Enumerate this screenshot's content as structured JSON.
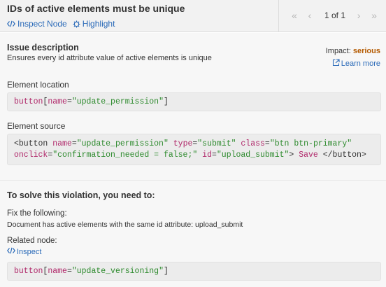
{
  "header": {
    "title": "IDs of active elements must be unique",
    "inspect_node_label": "Inspect Node",
    "highlight_label": "Highlight",
    "pager": {
      "count": "1 of 1",
      "first_icon": "double-chevron-left-icon",
      "prev_icon": "chevron-left-icon",
      "next_icon": "chevron-right-icon",
      "last_icon": "double-chevron-right-icon"
    }
  },
  "issue": {
    "title": "Issue description",
    "description": "Ensures every id attribute value of active elements is unique",
    "impact_label": "Impact:",
    "impact_value": "serious",
    "learn_more": "Learn more",
    "element_location_label": "Element location",
    "element_location": {
      "tag": "button",
      "bracket_open": "[",
      "attr": "name",
      "eq": "=",
      "value": "\"update_permission\"",
      "bracket_close": "]"
    },
    "element_source_label": "Element source",
    "element_source": {
      "open": "<button",
      "name_attr": "name",
      "name_val": "\"update_permission\"",
      "type_attr": "type",
      "type_val": "\"submit\"",
      "class_attr": "class",
      "class_val": "\"btn btn-primary\"",
      "onclick_attr": "onclick",
      "onclick_val": "\"confirmation_needed = false;\"",
      "id_attr": "id",
      "id_val": "\"upload_submit\"",
      "gt": ">",
      "text": " Save ",
      "close": "</button>"
    }
  },
  "solve": {
    "title": "To solve this violation, you need to:",
    "fix_label": "Fix the following:",
    "fix_text": "Document has active elements with the same id attribute: upload_submit",
    "related_label": "Related node:",
    "inspect_label": "Inspect",
    "related_node": {
      "tag": "button",
      "bracket_open": "[",
      "attr": "name",
      "eq": "=",
      "value": "\"update_versioning\"",
      "bracket_close": "]"
    }
  },
  "colors": {
    "link": "#2a6ab8",
    "impact_serious": "#b45a00",
    "code_tag": "#b0286a",
    "code_string": "#2d8a2d"
  }
}
